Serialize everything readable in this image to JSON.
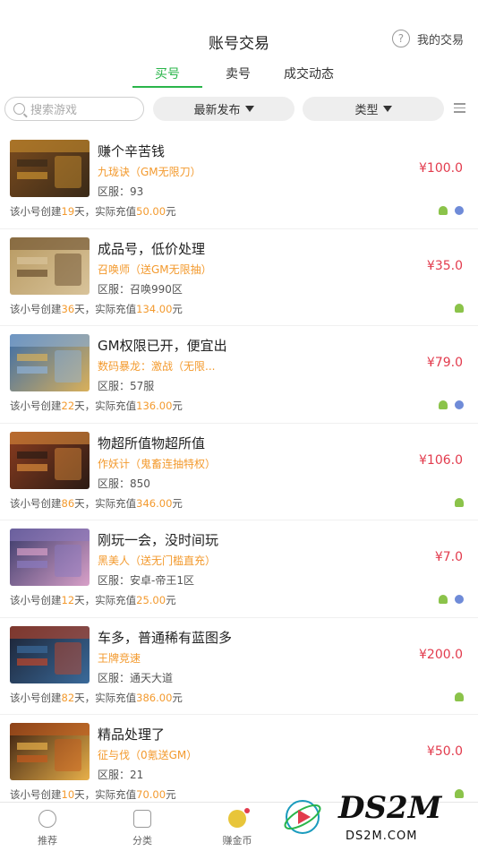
{
  "header": {
    "title": "账号交易",
    "my_trade": "我的交易",
    "help_glyph": "?"
  },
  "tabs": [
    {
      "label": "买号",
      "active": true
    },
    {
      "label": "卖号",
      "active": false
    },
    {
      "label": "成交动态",
      "active": false
    }
  ],
  "filters": {
    "search_placeholder": "搜索游戏",
    "latest": "最新发布",
    "type": "类型"
  },
  "listings": [
    {
      "title": "赚个辛苦钱",
      "game": "九珑诀（GM无限刀）",
      "server": "区服：93",
      "price": "¥100.0",
      "info_pre": "该小号创建",
      "days": "19",
      "info_mid": "天，实际充值",
      "amount": "50.00",
      "info_post": "元",
      "apple": true
    },
    {
      "title": "成品号，低价处理",
      "game": "召唤师（送GM无限抽）",
      "server": "区服：召唤990区",
      "price": "¥35.0",
      "info_pre": "该小号创建",
      "days": "36",
      "info_mid": "天，实际充值",
      "amount": "134.00",
      "info_post": "元",
      "apple": false
    },
    {
      "title": "GM权限已开，便宜出",
      "game": "数码暴龙：激战（无限...",
      "server": "区服：57服",
      "price": "¥79.0",
      "info_pre": "该小号创建",
      "days": "22",
      "info_mid": "天，实际充值",
      "amount": "136.00",
      "info_post": "元",
      "apple": true
    },
    {
      "title": "物超所值物超所值",
      "game": "作妖计（鬼畜连抽特权）",
      "server": "区服：850",
      "price": "¥106.0",
      "info_pre": "该小号创建",
      "days": "86",
      "info_mid": "天，实际充值",
      "amount": "346.00",
      "info_post": "元",
      "apple": false
    },
    {
      "title": "刚玩一会，没时间玩",
      "game": "黑美人（送无门槛直充）",
      "server": "区服：安卓-帝王1区",
      "price": "¥7.0",
      "info_pre": "该小号创建",
      "days": "12",
      "info_mid": "天，实际充值",
      "amount": "25.00",
      "info_post": "元",
      "apple": true
    },
    {
      "title": "车多，普通稀有蓝图多",
      "game": "王牌竞速",
      "server": "区服：通天大道",
      "price": "¥200.0",
      "info_pre": "该小号创建",
      "days": "82",
      "info_mid": "天，实际充值",
      "amount": "386.00",
      "info_post": "元",
      "apple": false
    },
    {
      "title": "精品处理了",
      "game": "征与伐（0氪送GM）",
      "server": "区服：21",
      "price": "¥50.0",
      "info_pre": "该小号创建",
      "days": "10",
      "info_mid": "天，实际充值",
      "amount": "70.00",
      "info_post": "元",
      "apple": false
    }
  ],
  "bottom_nav": [
    {
      "label": "推荐"
    },
    {
      "label": "分类"
    },
    {
      "label": "赚金币"
    }
  ],
  "watermark": {
    "logo": "DS2M",
    "site": "DS2M.COM"
  },
  "colors": {
    "accent_green": "#2ab54a",
    "price_red": "#e23b4d",
    "orange": "#f39a2e"
  }
}
